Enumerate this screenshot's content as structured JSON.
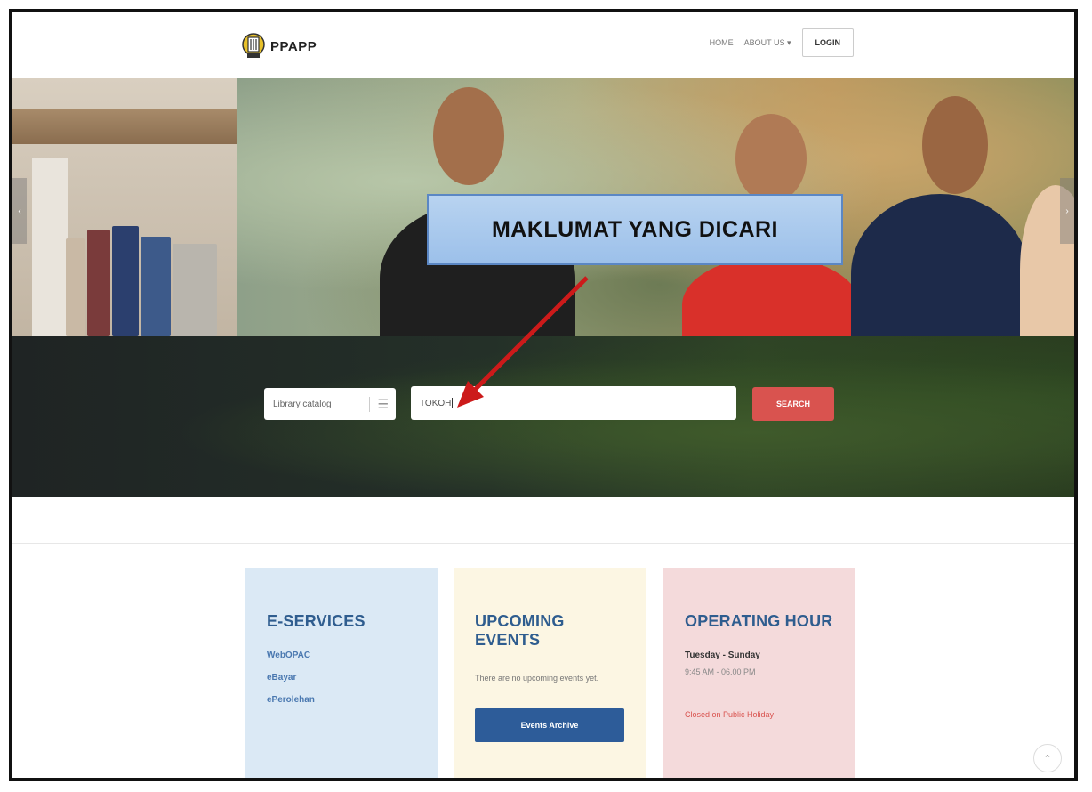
{
  "header": {
    "logo_text": "PPAPP",
    "nav": {
      "home": "HOME",
      "about": "ABOUT US ▾",
      "login": "LOGIN"
    }
  },
  "hero": {
    "annotation": "MAKLUMAT YANG DICARI",
    "prev_arrow": "‹",
    "next_arrow": "›"
  },
  "search": {
    "catalog_value": "Library catalog",
    "menu_icon": "☰",
    "query_value": "TOKOH",
    "button_label": "SEARCH"
  },
  "cards": {
    "eservices": {
      "title": "E-SERVICES",
      "links": [
        "WebOPAC",
        "eBayar",
        "ePerolehan"
      ]
    },
    "events": {
      "title": "UPCOMING EVENTS",
      "text": "There are no upcoming events yet.",
      "button": "Events Archive"
    },
    "hours": {
      "title": "OPERATING HOUR",
      "days": "Tuesday - Sunday",
      "time": "9:45 AM - 06.00 PM",
      "closed": "Closed on Public Holiday"
    }
  },
  "scroll_top_icon": "⌃",
  "colors": {
    "accent_red": "#d9534f",
    "primary_blue": "#2d5c99",
    "title_blue": "#2f5d8f"
  }
}
